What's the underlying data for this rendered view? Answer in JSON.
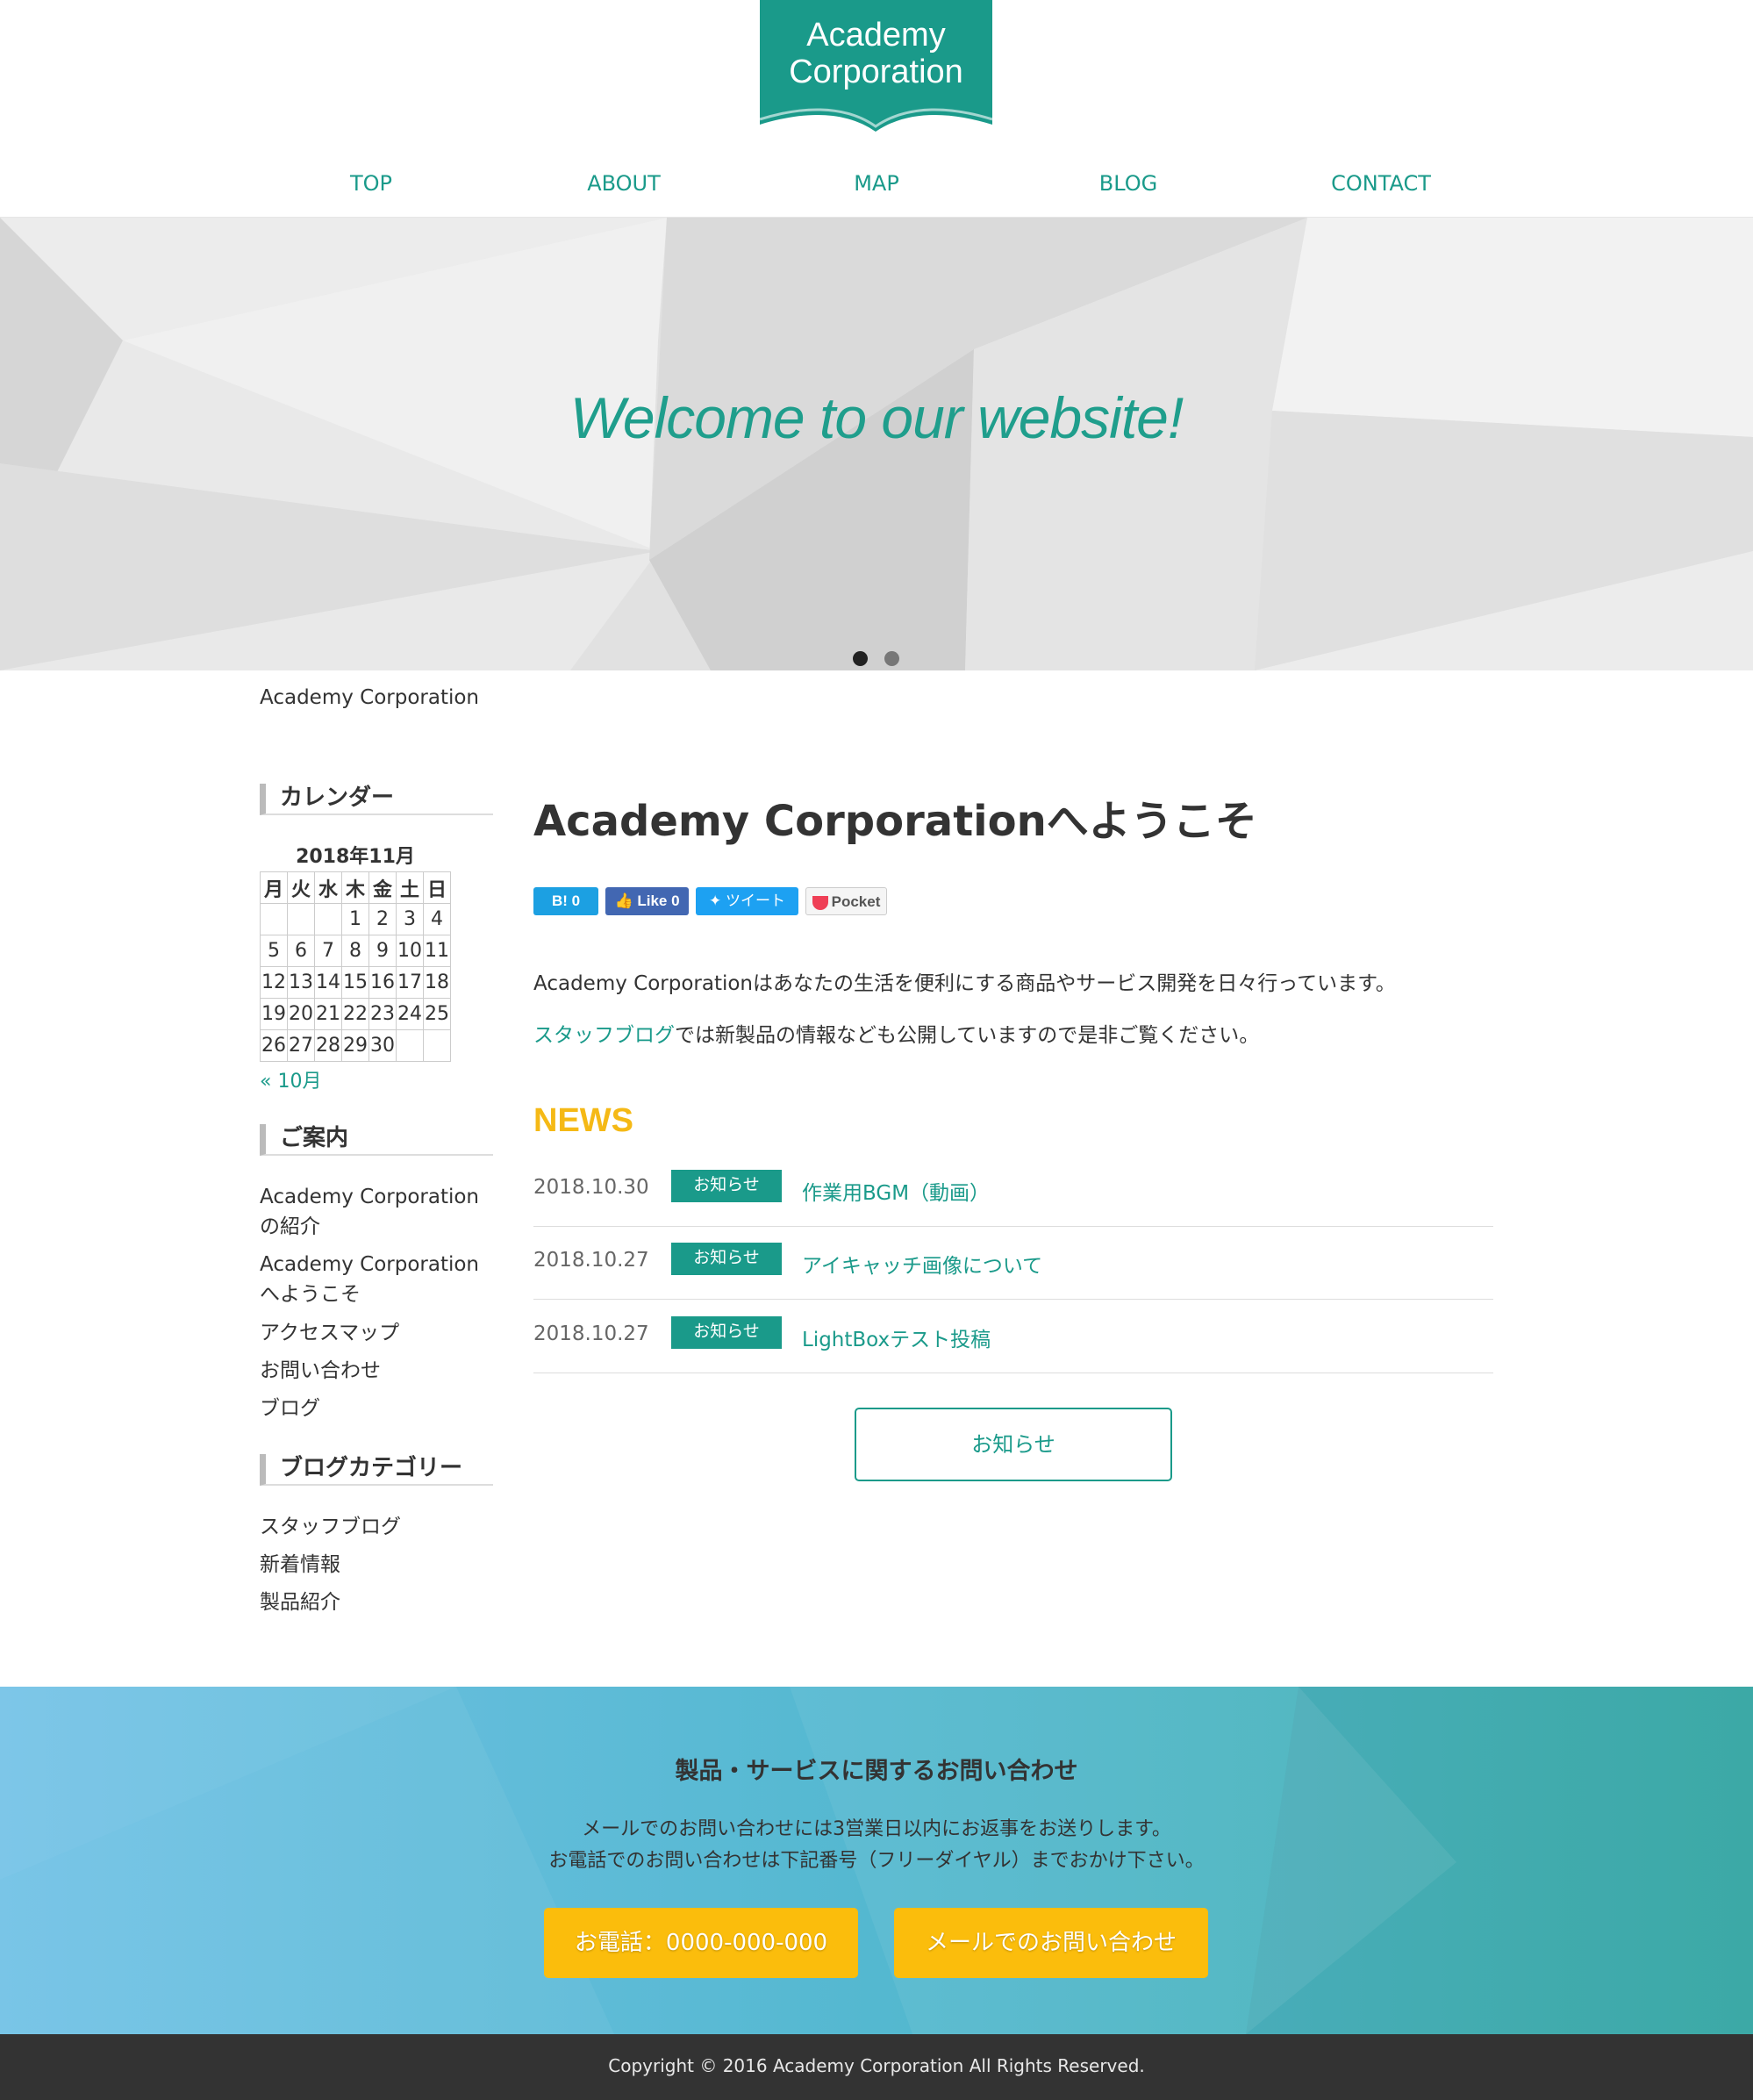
{
  "brand": {
    "line1": "Academy",
    "line2": "Corporation",
    "color": "#1a9a8a"
  },
  "nav": {
    "items": [
      "TOP",
      "ABOUT",
      "MAP",
      "BLOG",
      "CONTACT"
    ]
  },
  "hero": {
    "text": "Welcome to our website!",
    "slides_total": 2,
    "active_slide": 1
  },
  "breadcrumb": "Academy Corporation",
  "sidebar": {
    "calendar": {
      "heading": "カレンダー",
      "title": "2018年11月",
      "weekdays": [
        "月",
        "火",
        "水",
        "木",
        "金",
        "土",
        "日"
      ],
      "weeks": [
        [
          "",
          "",
          "",
          "1",
          "2",
          "3",
          "4"
        ],
        [
          "5",
          "6",
          "7",
          "8",
          "9",
          "10",
          "11"
        ],
        [
          "12",
          "13",
          "14",
          "15",
          "16",
          "17",
          "18"
        ],
        [
          "19",
          "20",
          "21",
          "22",
          "23",
          "24",
          "25"
        ],
        [
          "26",
          "27",
          "28",
          "29",
          "30",
          "",
          ""
        ]
      ],
      "prev": "« 10月"
    },
    "guide": {
      "heading": "ご案内",
      "links": [
        "Academy Corporationの紹介",
        "Academy Corporationへようこそ",
        "アクセスマップ",
        "お問い合わせ",
        "ブログ"
      ]
    },
    "categories": {
      "heading": "ブログカテゴリー",
      "links": [
        "スタッフブログ",
        "新着情報",
        "製品紹介"
      ]
    }
  },
  "main": {
    "title": "Academy Corporationへようこそ",
    "share": {
      "hatena": "B! 0",
      "facebook": "Like 0",
      "twitter": "ツイート",
      "pocket": "Pocket"
    },
    "intro": "Academy Corporationはあなたの生活を便利にする商品やサービス開発を日々行っています。",
    "intro2_link": "スタッフブログ",
    "intro2_rest": "では新製品の情報なども公開していますので是非ご覧ください。",
    "news_heading": "NEWS",
    "news": [
      {
        "date": "2018.10.30",
        "badge": "お知らせ",
        "title": "作業用BGM（動画）"
      },
      {
        "date": "2018.10.27",
        "badge": "お知らせ",
        "title": "アイキャッチ画像について"
      },
      {
        "date": "2018.10.27",
        "badge": "お知らせ",
        "title": "LightBoxテスト投稿"
      }
    ],
    "news_more": "お知らせ"
  },
  "contact": {
    "title": "製品・サービスに関するお問い合わせ",
    "line1": "メールでのお問い合わせには3営業日以内にお返事をお送りします。",
    "line2": "お電話でのお問い合わせは下記番号（フリーダイヤル）までおかけ下さい。",
    "phone_button": "お電話：0000-000-000",
    "mail_button": "メールでのお問い合わせ",
    "button_color": "#fbbd0c"
  },
  "footer": {
    "copyright": "Copyright © 2016 Academy Corporation All Rights Reserved."
  }
}
